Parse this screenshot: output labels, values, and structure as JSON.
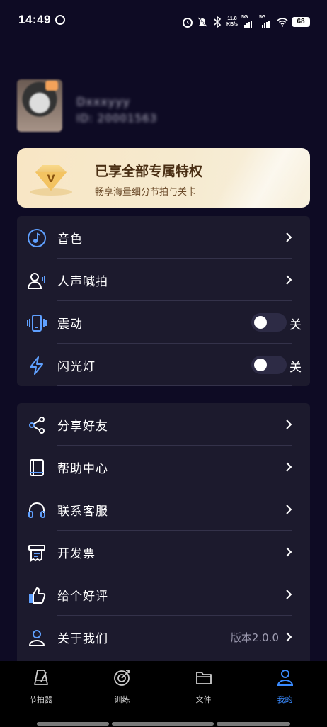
{
  "status_bar": {
    "time": "14:49",
    "net_speed_value": "11.8",
    "net_speed_unit": "KB/s",
    "signal1": "5G",
    "signal2": "5G",
    "battery": "68"
  },
  "profile": {
    "username": "Dxxxyyy",
    "user_id": "ID: 20001563"
  },
  "vip": {
    "title": "已享全部专属特权",
    "subtitle": "畅享海量细分节拍与关卡",
    "badge_letter": "V"
  },
  "settings": [
    {
      "label": "音色",
      "icon": "timbre-icon",
      "type": "chevron"
    },
    {
      "label": "人声喊拍",
      "icon": "voice-count-icon",
      "type": "chevron"
    },
    {
      "label": "震动",
      "icon": "vibrate-icon",
      "type": "toggle",
      "state": "关"
    },
    {
      "label": "闪光灯",
      "icon": "flash-icon",
      "type": "toggle",
      "state": "关"
    }
  ],
  "more": [
    {
      "label": "分享好友",
      "icon": "share-icon"
    },
    {
      "label": "帮助中心",
      "icon": "help-book-icon"
    },
    {
      "label": "联系客服",
      "icon": "headset-icon"
    },
    {
      "label": "开发票",
      "icon": "invoice-icon"
    },
    {
      "label": "给个好评",
      "icon": "thumbs-up-icon"
    },
    {
      "label": "关于我们",
      "icon": "user-icon",
      "value": "版本2.0.0"
    }
  ],
  "tabs": [
    {
      "label": "节拍器",
      "icon": "metronome-icon",
      "active": false
    },
    {
      "label": "训练",
      "icon": "target-icon",
      "active": false
    },
    {
      "label": "文件",
      "icon": "folder-icon",
      "active": false
    },
    {
      "label": "我的",
      "icon": "profile-icon",
      "active": true
    }
  ],
  "colors": {
    "background": "#0e0b24",
    "card": "#1c1a2d",
    "accent": "#3a8bff",
    "vip_gold": "#f6eacf"
  }
}
